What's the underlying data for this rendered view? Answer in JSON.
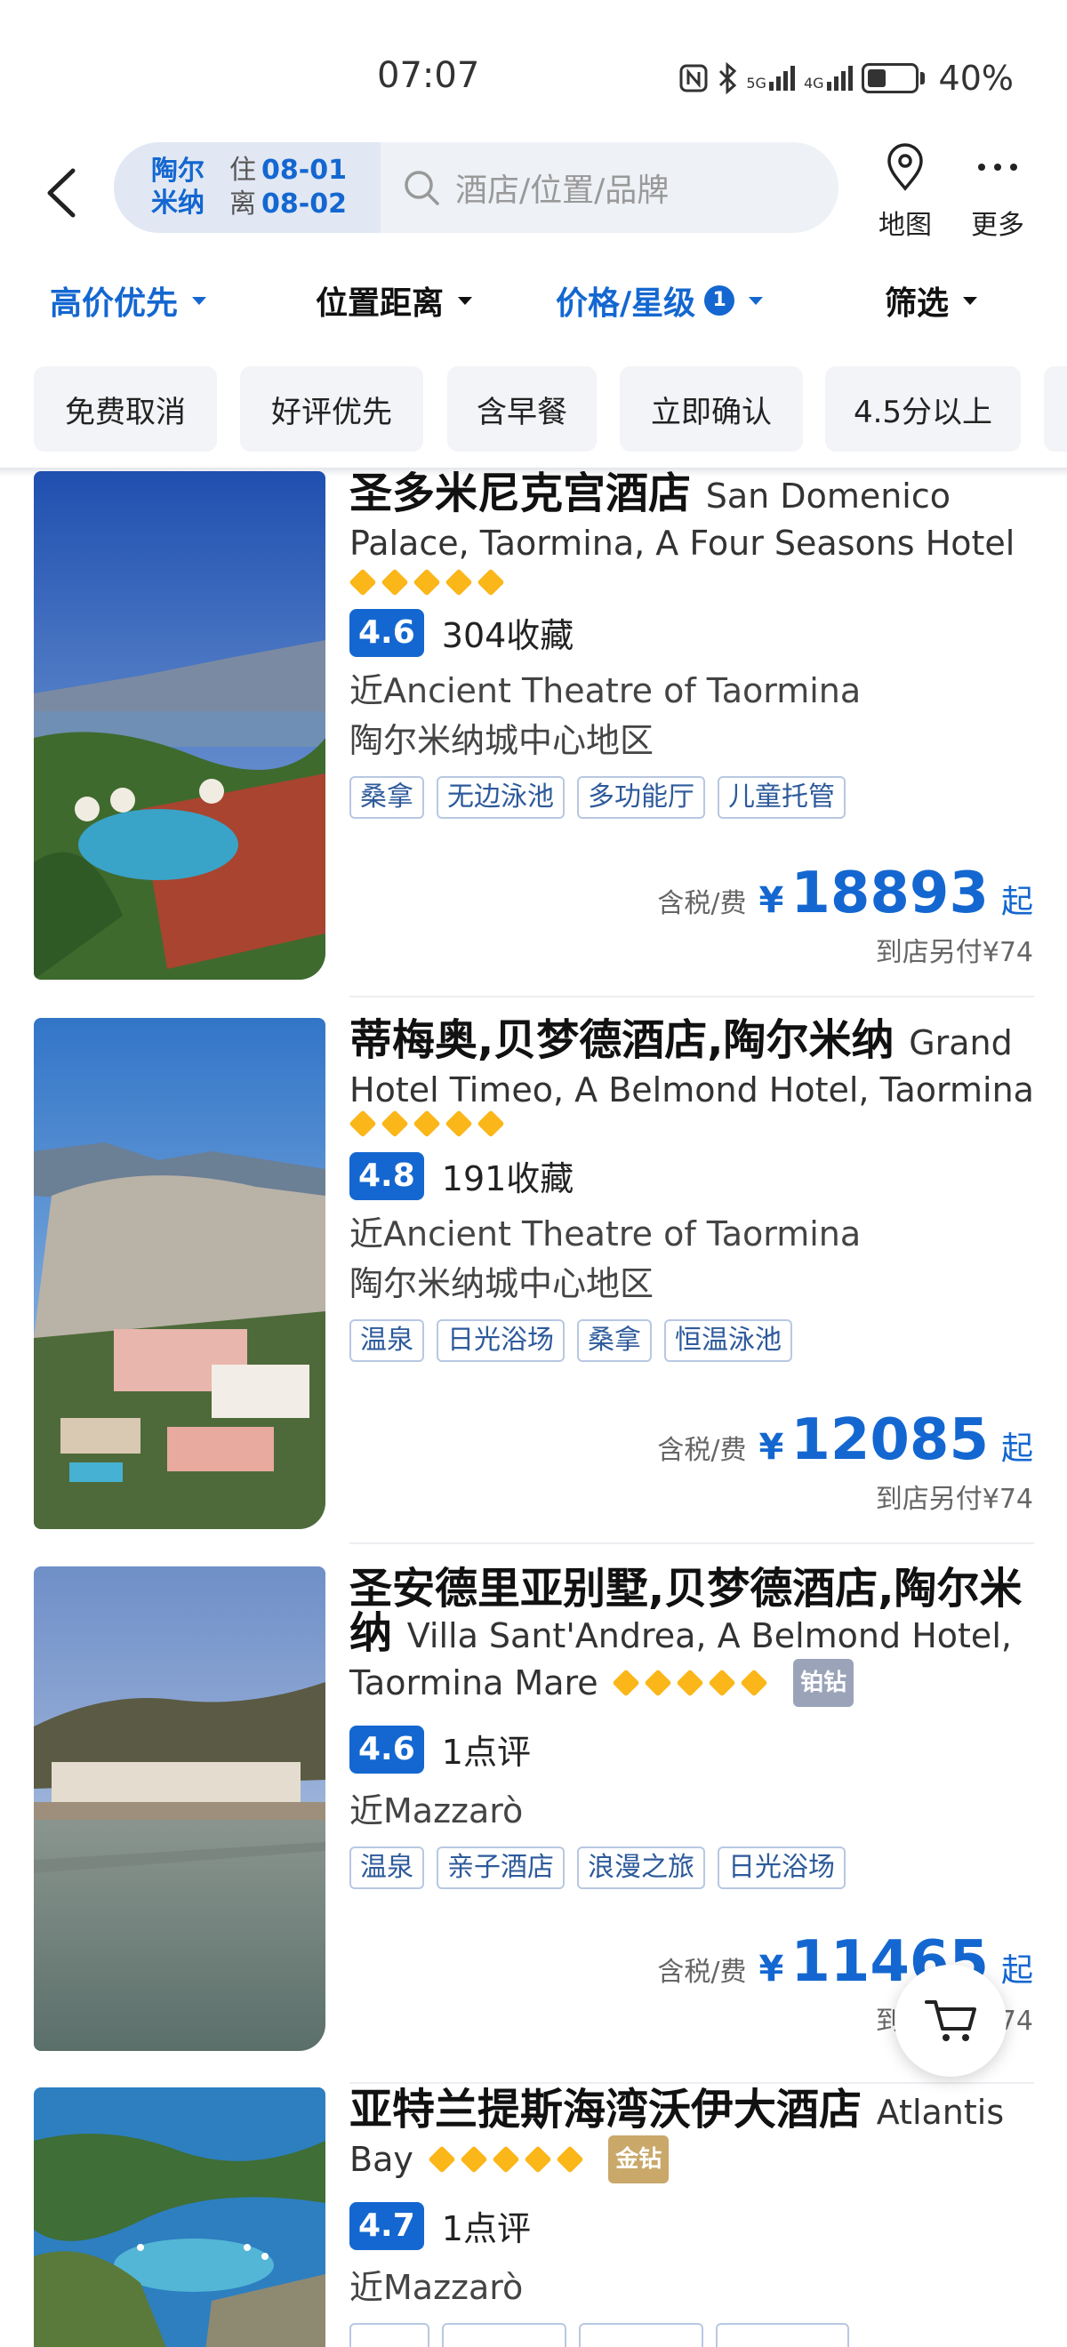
{
  "status_bar": {
    "time": "07:07",
    "battery": "40%",
    "network_1": "5G",
    "network_2": "4G"
  },
  "header": {
    "city": "陶尔米纳",
    "checkin_label": "住",
    "checkin_date": "08-01",
    "checkout_label": "离",
    "checkout_date": "08-02",
    "search_placeholder": "酒店/位置/品牌",
    "map_label": "地图",
    "more_label": "更多"
  },
  "sort_bar": {
    "items": [
      {
        "label": "高价优先",
        "active": true
      },
      {
        "label": "位置距离",
        "active": false
      },
      {
        "label": "价格/星级",
        "active": true,
        "badge": "1"
      },
      {
        "label": "筛选",
        "active": false
      }
    ]
  },
  "filters": [
    "免费取消",
    "好评优先",
    "含早餐",
    "立即确认",
    "4.5分以上"
  ],
  "hotels": [
    {
      "name_cn": "圣多米尼克宫酒店",
      "name_en": "San Domenico Palace, Taormina, A Four Seasons Hotel",
      "stars": 5,
      "score": "4.6",
      "reviews": "304收藏",
      "near": "近Ancient Theatre of Taormina",
      "area": "陶尔米纳城中心地区",
      "tags": [
        "桑拿",
        "无边泳池",
        "多功能厅",
        "儿童托管"
      ],
      "tax_label": "含税/费",
      "currency": "¥",
      "price": "18893",
      "price_suffix": "起",
      "extra": "到店另付¥74"
    },
    {
      "name_cn": "蒂梅奥,贝梦德酒店,陶尔米纳",
      "name_en": "Grand Hotel Timeo, A Belmond Hotel, Taormina",
      "stars": 5,
      "score": "4.8",
      "reviews": "191收藏",
      "near": "近Ancient Theatre of Taormina",
      "area": "陶尔米纳城中心地区",
      "tags": [
        "温泉",
        "日光浴场",
        "桑拿",
        "恒温泳池"
      ],
      "tax_label": "含税/费",
      "currency": "¥",
      "price": "12085",
      "price_suffix": "起",
      "extra": "到店另付¥74"
    },
    {
      "name_cn": "圣安德里亚别墅,贝梦德酒店,陶尔米纳",
      "name_en": "Villa Sant'Andrea, A Belmond Hotel, Taormina Mare",
      "stars": 5,
      "tier": "铂钻",
      "tier_color": "#9aa3b8",
      "score": "4.6",
      "reviews": "1点评",
      "near": "近Mazzarò",
      "tags": [
        "温泉",
        "亲子酒店",
        "浪漫之旅",
        "日光浴场"
      ],
      "tax_label": "含税/费",
      "currency": "¥",
      "price": "11465",
      "price_suffix": "起",
      "extra": "到店另付¥74"
    },
    {
      "name_cn": "亚特兰提斯海湾沃伊大酒店",
      "name_en": "Atlantis Bay",
      "stars": 5,
      "tier": "金钻",
      "tier_color": "#c9a86a",
      "score": "4.7",
      "reviews": "1点评",
      "near": "近Mazzarò"
    }
  ],
  "colors": {
    "accent": "#1467d0",
    "star": "#fbb619",
    "tag_border": "#b8c8e2"
  }
}
